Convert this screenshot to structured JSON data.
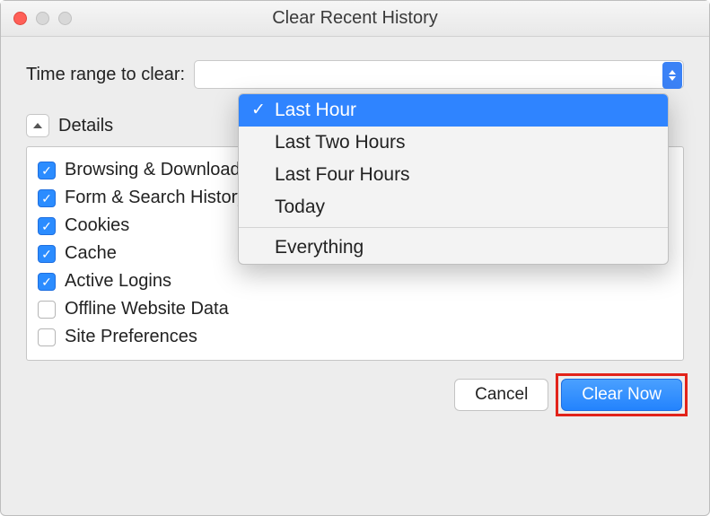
{
  "window": {
    "title": "Clear Recent History"
  },
  "time_range": {
    "label": "Time range to clear:",
    "selected": "Last Hour",
    "options": [
      "Last Hour",
      "Last Two Hours",
      "Last Four Hours",
      "Today",
      "Everything"
    ]
  },
  "details": {
    "label": "Details",
    "items": [
      {
        "label": "Browsing & Download History",
        "checked": true
      },
      {
        "label": "Form & Search History",
        "checked": true
      },
      {
        "label": "Cookies",
        "checked": true
      },
      {
        "label": "Cache",
        "checked": true
      },
      {
        "label": "Active Logins",
        "checked": true
      },
      {
        "label": "Offline Website Data",
        "checked": false
      },
      {
        "label": "Site Preferences",
        "checked": false
      }
    ]
  },
  "buttons": {
    "cancel": "Cancel",
    "clear_now": "Clear Now"
  }
}
